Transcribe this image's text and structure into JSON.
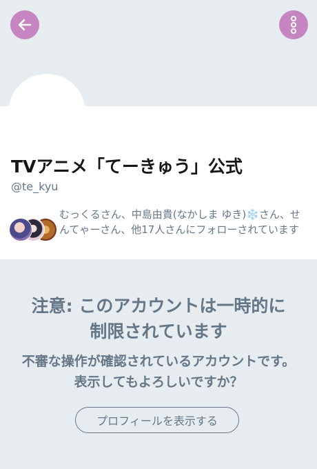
{
  "profile": {
    "name": "TVアニメ「てーきゅう」公式",
    "handle": "@te_kyu",
    "followed_by": "むっくるさん、中島由貴(なかしま ゆき)❄️さん、せんてゃーさん、他17人さんにフォローされています"
  },
  "notice": {
    "title": "注意: このアカウントは一時的に制限されています",
    "body": "不審な操作が確認されているアカウントです。表示してもよろしいですか？",
    "button_label": "プロフィールを表示する"
  },
  "icons": {
    "back": "arrow-left-icon",
    "more": "more-vertical-icon"
  },
  "colors": {
    "accent": "#c585c0",
    "background": "#e6ecf0",
    "muted_text": "#657786"
  }
}
